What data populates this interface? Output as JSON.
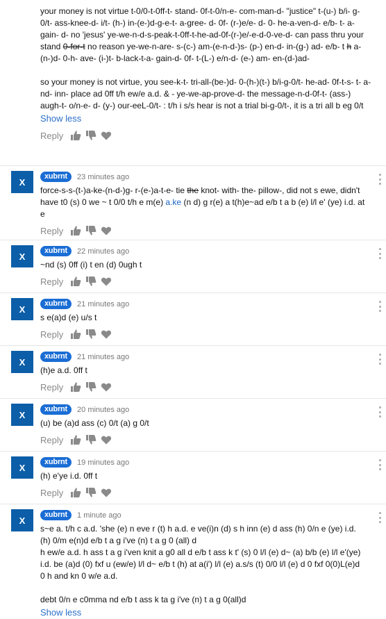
{
  "top_comment": {
    "paragraph1_a": "your money is not virtue t-0/0-t-0ff-t- stand- 0f-t-0/n-e- com-man-d- \"justice\" t-(u-) b/i- g- 0/t- ass-knee-d- i/t- (h-) in-(e-)d-g-e-t- a-gree- d- 0f- (r-)e/e- d- 0- he-a-ven-d- e/b- t- a- gain- d- no 'jesus' ye-we-n-d-s-peak-t-0ff-t-he-ad-0f-(r-)e/-e-d-0-ve-d- can pass thru your stand ",
    "paragraph1_strike": "0-for-t",
    "paragraph1_b": " no reason ye-we-n-are- s-(c-) am-(e-n-d-)s- (p-) en-d- in-(g-) ad- e/b- t ",
    "paragraph1_strike2": "h",
    "paragraph1_c": " a-(n-)d- 0-h- ave- (i-)t- b-lack-t-a- gain-d- 0f- t-(L-) e/n-d- (e-) am- en-(d-)ad-",
    "paragraph2": "so your money is not virtue, you see-k-t- tri-all-(be-)d- 0-(h-)(t-) b/i-g-0/t- he-ad- 0f-t-s- t- a- nd- inn- place ad 0ff t/h ew/e a.d. & - ye-we-ap-prove-d- the message-n-d-0f-t- (ass-) augh-t- o/n-e- d- (y-) our-eeL-0/t- : t/h i s/s hear is not a trial bi-g-0/t-, it is a tri all b eg 0/t",
    "show_less": "Show less"
  },
  "actions": {
    "reply_label": "Reply",
    "like_icon": "thumbs-up-icon",
    "dislike_icon": "thumbs-down-icon",
    "heart_icon": "heart-icon"
  },
  "comments": [
    {
      "avatar": "X",
      "author": "xubrnt",
      "time": "23 minutes ago",
      "text_a": "force-s-s-(t-)a-ke-(n-d-)g- r-(e-)a-t-e- tie ",
      "text_strike": "the",
      "text_b": " knot- with- the- pillow-, did not s ewe, didn't have t0 (s) 0 we ~ t 0/0 t/h e m(e) ",
      "text_link": "a.ke",
      "text_c": " (n d) g r(e) a t(h)e~ad e/b t a b (e) l/l e' (ye) i.d. at e"
    },
    {
      "avatar": "X",
      "author": "xubrnt",
      "time": "22 minutes ago",
      "text": "~nd (s) 0ff (i) t en (d) 0ugh t"
    },
    {
      "avatar": "X",
      "author": "xubrnt",
      "time": "21 minutes ago",
      "text": "s e(a)d (e) u/s t"
    },
    {
      "avatar": "X",
      "author": "xubrnt",
      "time": "21 minutes ago",
      "text": "(h)e a.d. 0ff t"
    },
    {
      "avatar": "X",
      "author": "xubrnt",
      "time": "20 minutes ago",
      "text": "(u) be (a)d ass (c) 0/t (a) g 0/t"
    },
    {
      "avatar": "X",
      "author": "xubrnt",
      "time": "19 minutes ago",
      "text": "(h) e'ye i.d. 0ff t"
    },
    {
      "avatar": "X",
      "author": "xubrnt",
      "time": "1 minute ago",
      "text": "s~e a. t/h c a.d. 'she (e) n eve r (t) h a.d. e ve(i)n (d) s h inn (e) d ass (h) 0/n e (ye) i.d. (h) 0/m e(n)d e/b t a g i've (n) t a g 0 (all) d\nh ew/e a.d. h ass t a g i'ven knit a g0 all d e/b t ass k t' (s) 0 l/l (e) d~ (a) b/b (e) l/l e'(ye) i.d. be (a)d (0) fxf u (ew/e) l/l d~ e/b t (h) at a(i') l/l (e) a.s/s (t) 0/0 l/l (e) d 0 fxf 0(0)L(e)d 0 h and kn 0 w/e a.d.\n\ndebt 0/n e c0mma nd e/b t ass k ta g i've (n) t a g 0(all)d",
      "show_less": "Show less"
    }
  ]
}
